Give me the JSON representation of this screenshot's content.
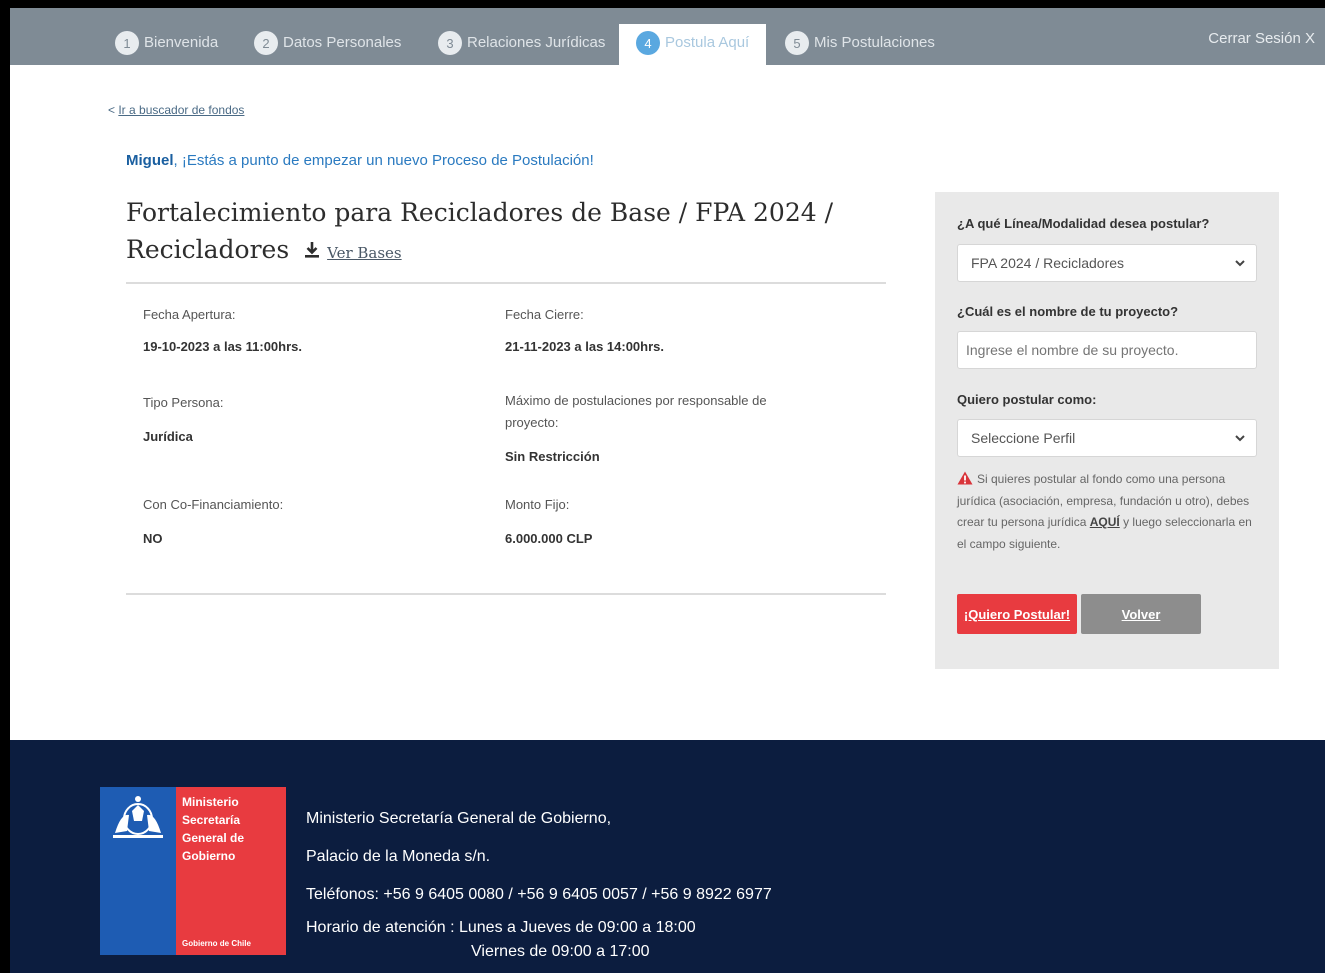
{
  "nav": {
    "steps": [
      {
        "num": "1",
        "label": "Bienvenida"
      },
      {
        "num": "2",
        "label": "Datos Personales"
      },
      {
        "num": "3",
        "label": "Relaciones Jurídicas"
      },
      {
        "num": "4",
        "label": "Postula Aquí"
      },
      {
        "num": "5",
        "label": "Mis Postulaciones"
      }
    ],
    "active_index": 4,
    "logout": "Cerrar Sesión X"
  },
  "back_link": {
    "prefix": "< ",
    "label": "Ir a buscador de fondos"
  },
  "greeting": {
    "name": "Miguel",
    "text": ", ¡Estás a punto de empezar un nuevo Proceso de Postulación!"
  },
  "fund": {
    "title": "Fortalecimiento para Recicladores de Base / FPA 2024 / Recicladores",
    "bases_label": "Ver Bases",
    "download_icon": "download-icon"
  },
  "details": {
    "apertura_label": "Fecha Apertura:",
    "apertura_value": "19-10-2023 a las 11:00hrs.",
    "cierre_label": "Fecha Cierre:",
    "cierre_value": "21-11-2023 a las 14:00hrs.",
    "tipo_label": "Tipo Persona:",
    "tipo_value": "Jurídica",
    "maximo_label": "Máximo de postulaciones por responsable de proyecto:",
    "maximo_value": "Sin Restricción",
    "cofin_label": "Con Co-Financiamiento:",
    "cofin_value": "NO",
    "monto_label": "Monto Fijo:",
    "monto_value": "6.000.000 CLP"
  },
  "form": {
    "linea_label": "¿A qué Línea/Modalidad desea postular?",
    "linea_value": "FPA 2024 / Recicladores",
    "nombre_label": "¿Cuál es el nombre de tu proyecto?",
    "nombre_placeholder": "Ingrese el nombre de su proyecto.",
    "perfil_label": "Quiero postular como:",
    "perfil_value": "Seleccione Perfil",
    "warning_before": "Si quieres postular al fondo como una persona jurídica (asociación, empresa, fundación u otro), debes crear tu persona jurídica ",
    "warning_link": "AQUÍ",
    "warning_after": " y luego seleccionarla en el campo siguiente.",
    "submit_label": "¡Quiero Postular!",
    "back_label": "Volver"
  },
  "footer": {
    "logo_lines": [
      "Ministerio",
      "Secretaría",
      "General de",
      "Gobierno"
    ],
    "logo_sub": "Gobierno de Chile",
    "line1": "Ministerio Secretaría General de Gobierno,",
    "line2": "Palacio de la Moneda s/n.",
    "line3": "Teléfonos: +56 9 6405 0080 / +56 9 6405 0057 / +56 9 8922 6977",
    "line4": "Horario de atención : Lunes a Jueves de 09:00 a 18:00",
    "line5": "Viernes de 09:00 a 17:00"
  },
  "colors": {
    "nav_bg": "#7f8b95",
    "accent_blue": "#2a7ac0",
    "button_red": "#e83b40",
    "button_grey": "#8d8d8d",
    "footer_bg": "#0c1d3f"
  }
}
